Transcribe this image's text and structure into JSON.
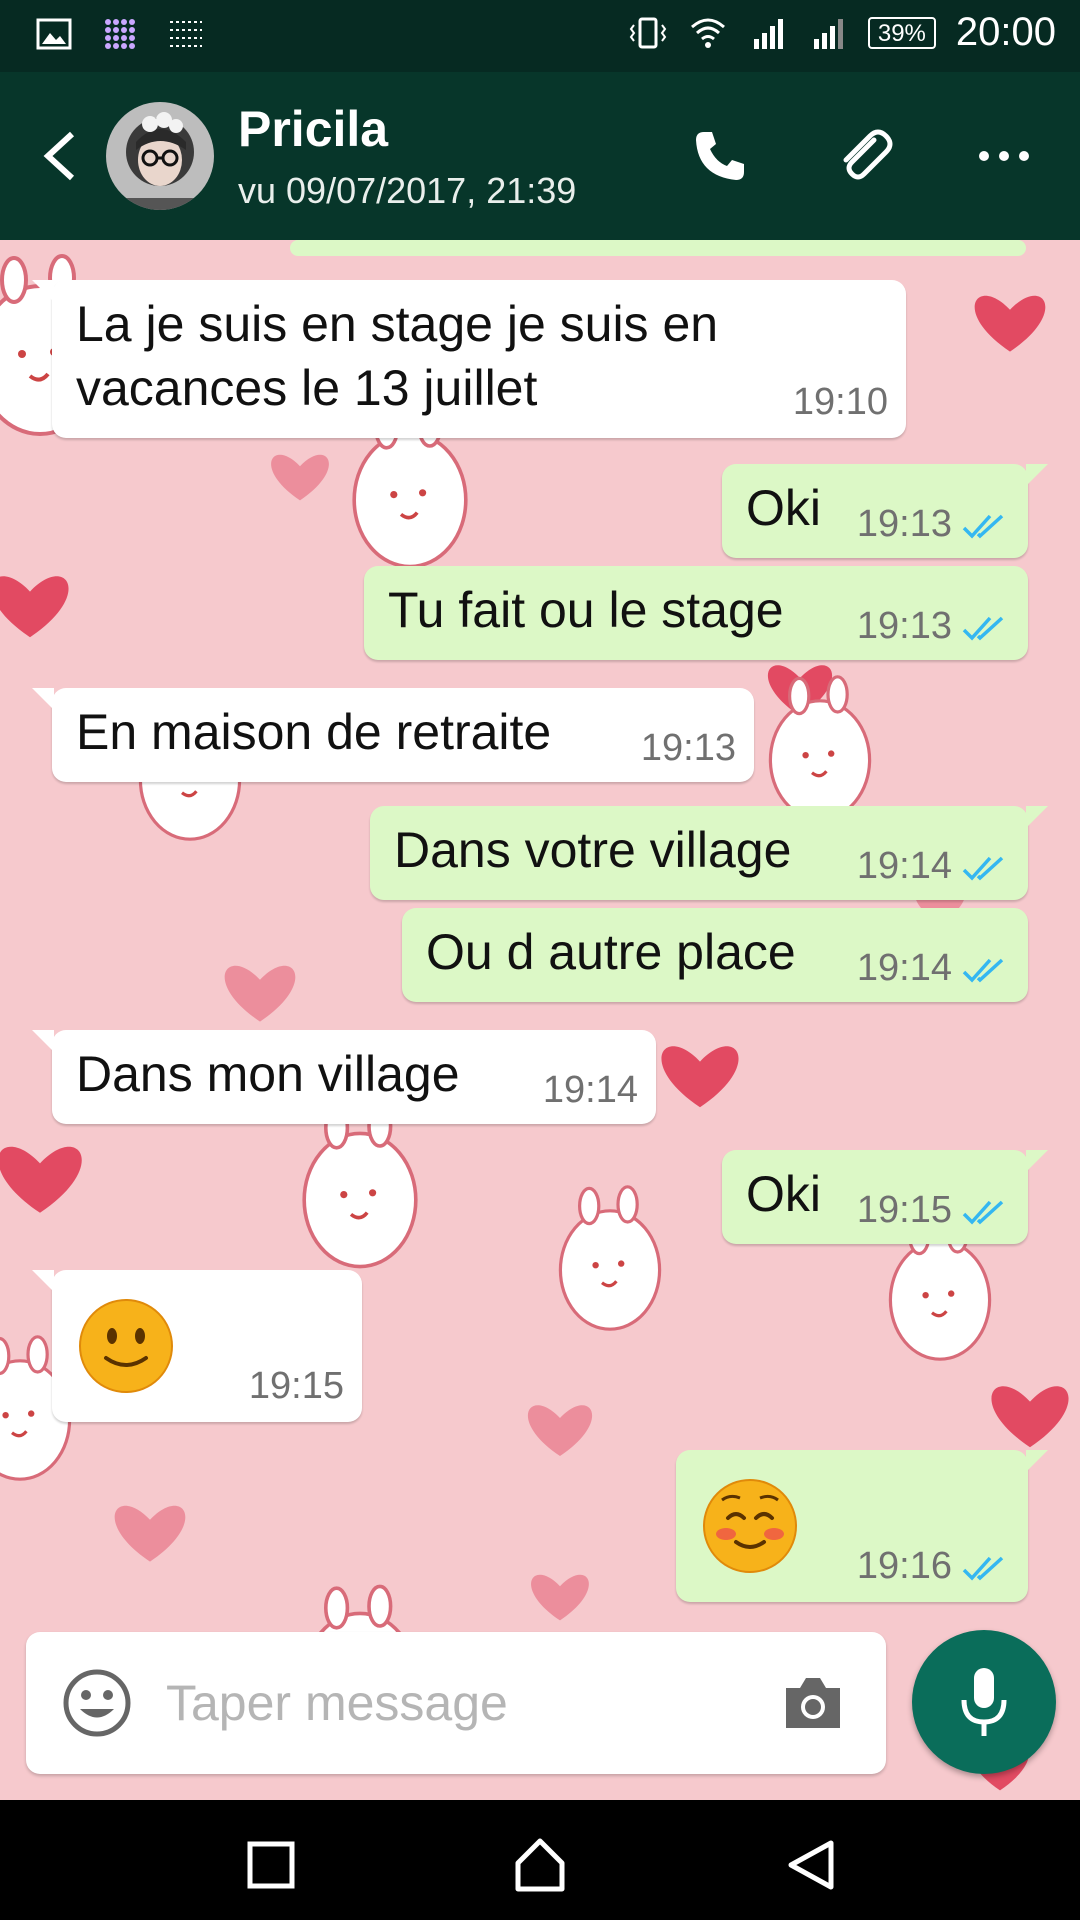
{
  "status_bar": {
    "battery": "39%",
    "time": "20:00",
    "icons": [
      "gallery-icon",
      "app-grid-icon",
      "notification-icon",
      "vibrate-icon",
      "wifi-icon",
      "signal-icon",
      "signal-icon"
    ]
  },
  "header": {
    "contact_name": "Pricila",
    "last_seen": "vu 09/07/2017, 21:39",
    "actions": [
      "phone-icon",
      "attach-icon",
      "more-icon"
    ]
  },
  "colors": {
    "header_bg": "#07362a",
    "status_bg": "#062a22",
    "incoming_bubble": "#ffffff",
    "outgoing_bubble": "#dcf8c6",
    "read_ticks": "#34b7f1",
    "mic_button": "#0a6d5a",
    "wallpaper_pink": "#f6c9cd"
  },
  "messages": [
    {
      "dir": "in",
      "lines": [
        "La je suis en stage je suis en",
        "vacances le 13 juillet"
      ],
      "time": "19:10"
    },
    {
      "dir": "out",
      "lines": [
        "Oki"
      ],
      "time": "19:13",
      "read": true
    },
    {
      "dir": "out",
      "lines": [
        "Tu fait ou le stage"
      ],
      "time": "19:13",
      "read": true
    },
    {
      "dir": "in",
      "lines": [
        "En maison de retraite"
      ],
      "time": "19:13"
    },
    {
      "dir": "out",
      "lines": [
        "Dans votre village"
      ],
      "time": "19:14",
      "read": true
    },
    {
      "dir": "out",
      "lines": [
        "Ou d autre place"
      ],
      "time": "19:14",
      "read": true
    },
    {
      "dir": "in",
      "lines": [
        "Dans mon village"
      ],
      "time": "19:14"
    },
    {
      "dir": "out",
      "lines": [
        "Oki"
      ],
      "time": "19:15",
      "read": true
    },
    {
      "dir": "in",
      "emoji": "slightly-smiling-face",
      "time": "19:15"
    },
    {
      "dir": "out",
      "emoji": "smiling-face-blushing",
      "time": "19:16",
      "read": true
    }
  ],
  "composer": {
    "placeholder": "Taper message"
  },
  "navbar": [
    "recent-apps-icon",
    "home-icon",
    "back-icon"
  ]
}
